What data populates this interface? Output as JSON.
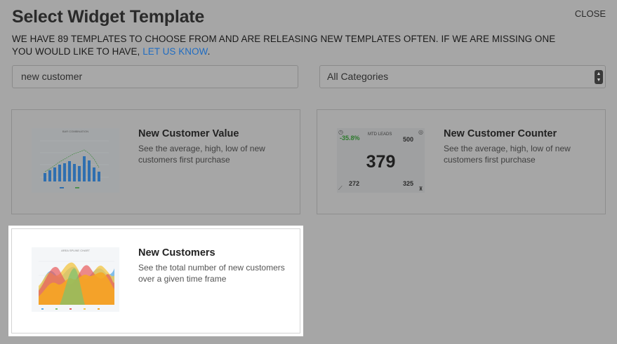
{
  "header": {
    "title": "Select Widget Template",
    "close_label": "CLOSE",
    "intro_text": "WE HAVE 89 TEMPLATES TO CHOOSE FROM AND ARE RELEASING NEW TEMPLATES OFTEN. IF WE ARE MISSING ONE YOU WOULD LIKE TO HAVE, ",
    "intro_link": "LET US KNOW",
    "intro_end": "."
  },
  "search": {
    "value": "new customer"
  },
  "category_select": {
    "selected": "All Categories"
  },
  "cards": [
    {
      "title": "New Customer Value",
      "description": "See the average, high, low of new customers first purchase",
      "thumbnail_title": "BAR COMBINATION",
      "selected": false
    },
    {
      "title": "New Customer Counter",
      "description": "See the average, high, low of new customers first purchase",
      "counter": {
        "change": "-35.8%",
        "label": "MTD LEADS",
        "target": "500",
        "value": "379",
        "low": "272",
        "high": "325"
      },
      "selected": false
    },
    {
      "title": "New Customers",
      "description": "See the total number of new customers over a given time frame",
      "thumbnail_title": "AREA SPLINE CHART",
      "selected": true
    }
  ],
  "colors": {
    "backdrop": "#a6a6a6",
    "link": "#1f6cc2",
    "selected_card": "#ffffff",
    "positive": "#2d7a2d"
  },
  "icons": [
    "clock-icon",
    "target-icon",
    "trend-icon",
    "trophy-icon",
    "select-arrows-icon"
  ]
}
